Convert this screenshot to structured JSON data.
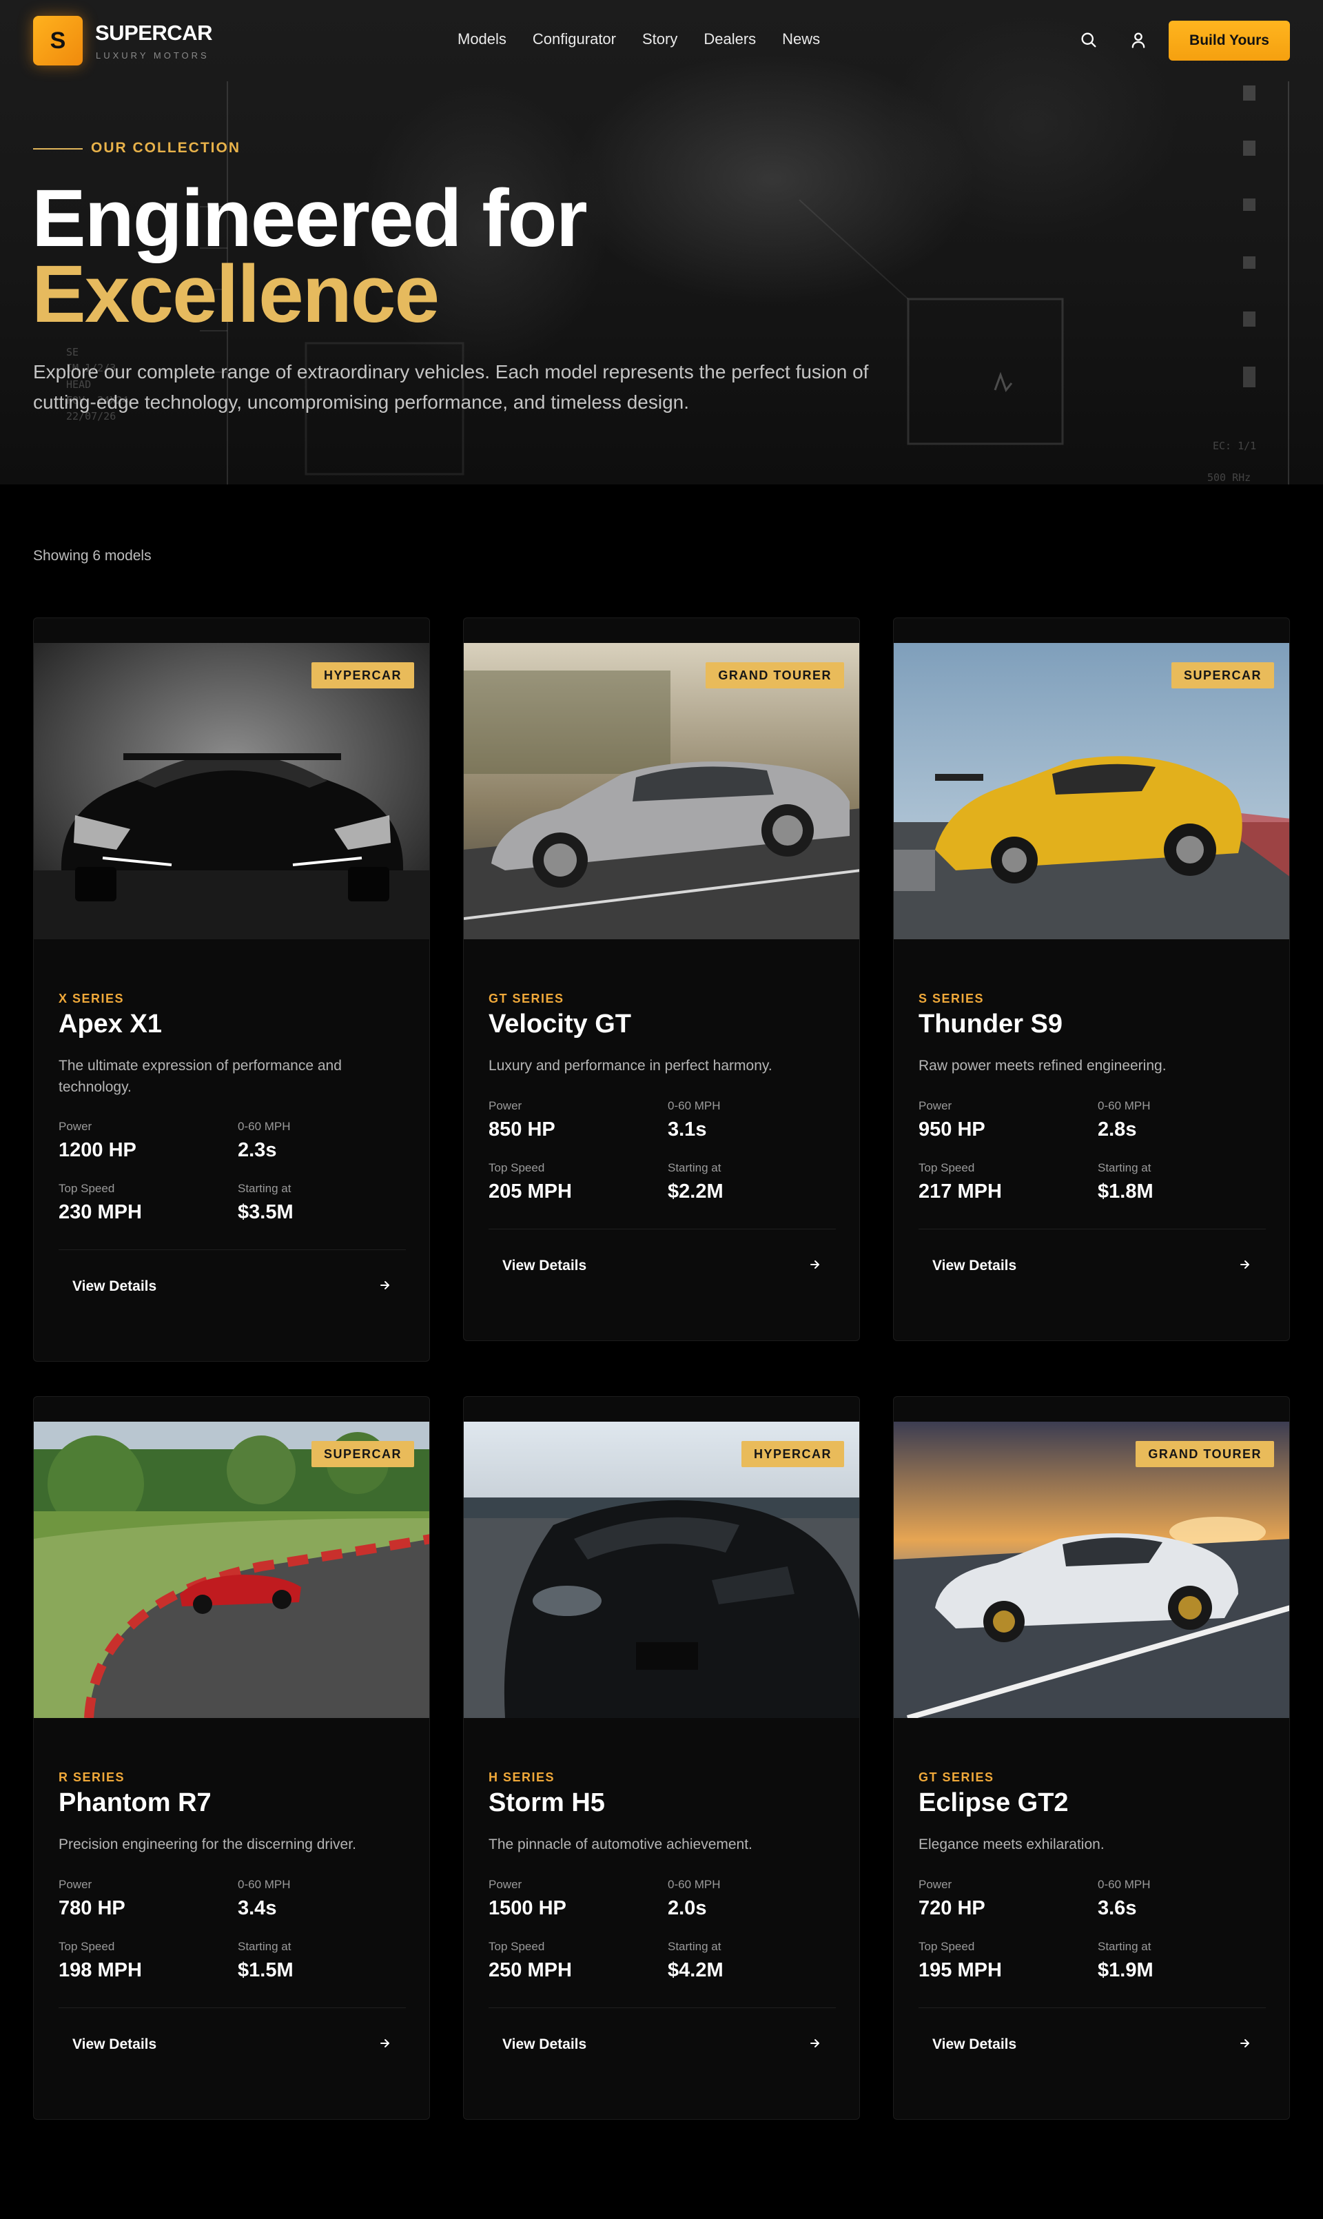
{
  "brand": {
    "logo_letter": "S",
    "name": "SUPERCAR",
    "tagline": "LUXURY MOTORS"
  },
  "nav": {
    "links": [
      "Models",
      "Configurator",
      "Story",
      "Dealers",
      "News"
    ],
    "search_icon": "search-icon",
    "account_icon": "user-icon",
    "cta": "Build Yours"
  },
  "hero": {
    "eyebrow": "OUR COLLECTION",
    "title_line1": "Engineered for",
    "title_line2": "Excellence",
    "description": "Explore our complete range of extraordinary vehicles. Each model represents the perfect fusion of cutting-edge technology, uncompromising performance, and timeless design.",
    "overlay_text": {
      "left_lines": [
        "SE",
        "IM 1/2/3",
        "HEAD",
        "FOV: 24X24",
        "22/07/26"
      ],
      "right_top": "EC: 1/1",
      "right_bottom": "500 RHz"
    }
  },
  "listing": {
    "count_text": "Showing 6 models",
    "spec_labels": {
      "power": "Power",
      "accel": "0-60 MPH",
      "top_speed": "Top Speed",
      "price": "Starting at"
    },
    "details_label": "View Details",
    "models": [
      {
        "badge": "HYPERCAR",
        "series": "X SERIES",
        "name": "Apex X1",
        "description": "The ultimate expression of performance and technology.",
        "power": "1200 HP",
        "accel": "2.3s",
        "top_speed": "230 MPH",
        "price": "$3.5M"
      },
      {
        "badge": "GRAND TOURER",
        "series": "GT SERIES",
        "name": "Velocity GT",
        "description": "Luxury and performance in perfect harmony.",
        "power": "850 HP",
        "accel": "3.1s",
        "top_speed": "205 MPH",
        "price": "$2.2M"
      },
      {
        "badge": "SUPERCAR",
        "series": "S SERIES",
        "name": "Thunder S9",
        "description": "Raw power meets refined engineering.",
        "power": "950 HP",
        "accel": "2.8s",
        "top_speed": "217 MPH",
        "price": "$1.8M"
      },
      {
        "badge": "SUPERCAR",
        "series": "R SERIES",
        "name": "Phantom R7",
        "description": "Precision engineering for the discerning driver.",
        "power": "780 HP",
        "accel": "3.4s",
        "top_speed": "198 MPH",
        "price": "$1.5M"
      },
      {
        "badge": "HYPERCAR",
        "series": "H SERIES",
        "name": "Storm H5",
        "description": "The pinnacle of automotive achievement.",
        "power": "1500 HP",
        "accel": "2.0s",
        "top_speed": "250 MPH",
        "price": "$4.2M"
      },
      {
        "badge": "GRAND TOURER",
        "series": "GT SERIES",
        "name": "Eclipse GT2",
        "description": "Elegance meets exhilaration.",
        "power": "720 HP",
        "accel": "3.6s",
        "top_speed": "195 MPH",
        "price": "$1.9M"
      }
    ]
  },
  "colors": {
    "accent": "#f5a00f",
    "gold": "#e6ba5e",
    "background": "#000000",
    "card": "#0b0b0b"
  }
}
